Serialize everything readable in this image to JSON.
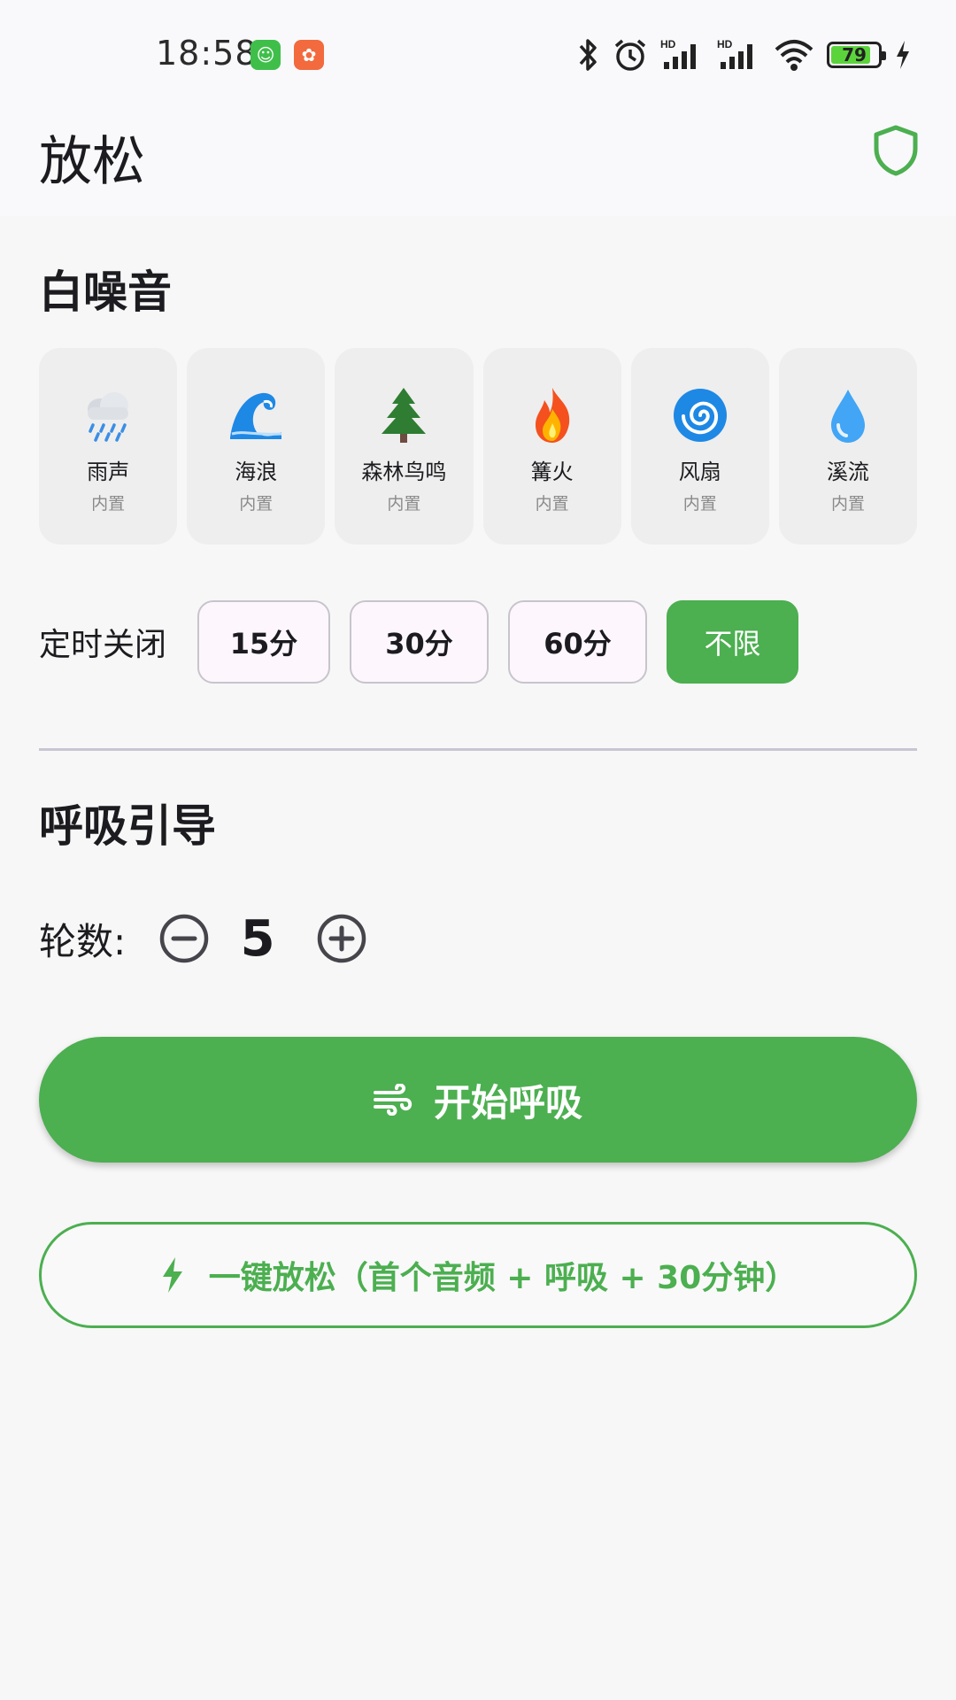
{
  "status_bar": {
    "time": "18:58",
    "battery": "79"
  },
  "header": {
    "title": "放松"
  },
  "white_noise": {
    "title": "白噪音",
    "sounds": [
      {
        "emoji": "🌧️",
        "name": "雨声",
        "tag": "内置"
      },
      {
        "emoji": "🌊",
        "name": "海浪",
        "tag": "内置"
      },
      {
        "emoji": "🌲",
        "name": "森林鸟鸣",
        "tag": "内置"
      },
      {
        "emoji": "🔥",
        "name": "篝火",
        "tag": "内置"
      },
      {
        "emoji": "🌀",
        "name": "风扇",
        "tag": "内置"
      },
      {
        "emoji": "💧",
        "name": "溪流",
        "tag": "内置"
      }
    ]
  },
  "timer": {
    "label": "定时关闭",
    "options": [
      "15分",
      "30分",
      "60分",
      "不限"
    ],
    "selected": "不限"
  },
  "breathing": {
    "title": "呼吸引导",
    "rounds_label": "轮数:",
    "rounds_value": "5",
    "start_label": "开始呼吸",
    "one_key_label": "一键放松（首个音频 + 呼吸 + 30分钟）"
  },
  "colors": {
    "accent": "#4caf50",
    "card_bg": "#eeeeee",
    "chip_bg": "#fdf7fd"
  }
}
